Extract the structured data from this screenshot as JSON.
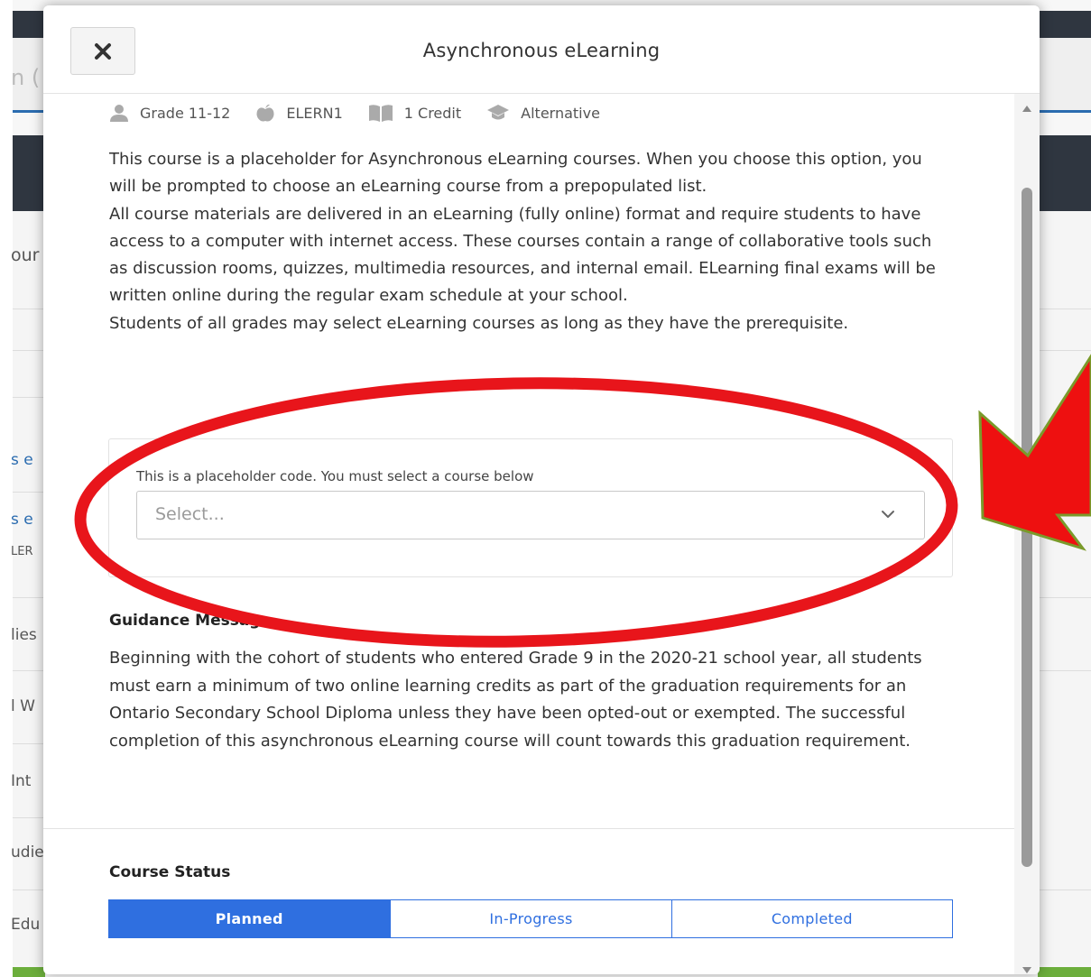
{
  "background": {
    "fragments": [
      "n (",
      "our",
      "s e",
      "s e",
      "LER",
      "lies",
      "l W",
      "Int",
      "udie",
      "Edu"
    ]
  },
  "modal": {
    "title": "Asynchronous eLearning",
    "close_icon": "close-icon",
    "meta": {
      "grade": "Grade 11-12",
      "code": "ELERN1",
      "credit": "1 Credit",
      "pathway": "Alternative"
    },
    "description": [
      "This course is a placeholder for Asynchronous eLearning courses. When you choose this option, you will be prompted to choose an eLearning course from a prepopulated list.",
      "All course materials are delivered in an eLearning (fully online) format and require students to have access to a computer with internet access. These courses contain a range of collaborative tools such as discussion rooms, quizzes, multimedia resources, and internal email. ELearning final exams will be written online during the regular exam schedule at your school.",
      "Students of all grades may select eLearning courses as long as they have the prerequisite."
    ],
    "select": {
      "label": "This is a placeholder code. You must select a course below",
      "placeholder": "Select..."
    },
    "guidance": {
      "title": "Guidance Message",
      "text": "Beginning with the cohort of students who entered Grade 9 in the 2020-21 school year, all students must earn a minimum of two online learning credits as part of the graduation requirements for an Ontario Secondary School Diploma unless they have been opted-out or exempted. The successful completion of this asynchronous eLearning course will count towards this graduation requirement."
    },
    "course_status": {
      "title": "Course Status",
      "options": [
        "Planned",
        "In-Progress",
        "Completed"
      ],
      "selected": "Planned"
    }
  },
  "annotation": {
    "ellipse_color": "#e8151b",
    "arrow_color": "#ee1010",
    "arrow_outline": "#7a9a2a"
  },
  "colors": {
    "accent": "#2f6fe0",
    "dark_bar": "#2f3640",
    "green_bar": "#6cae3c"
  }
}
